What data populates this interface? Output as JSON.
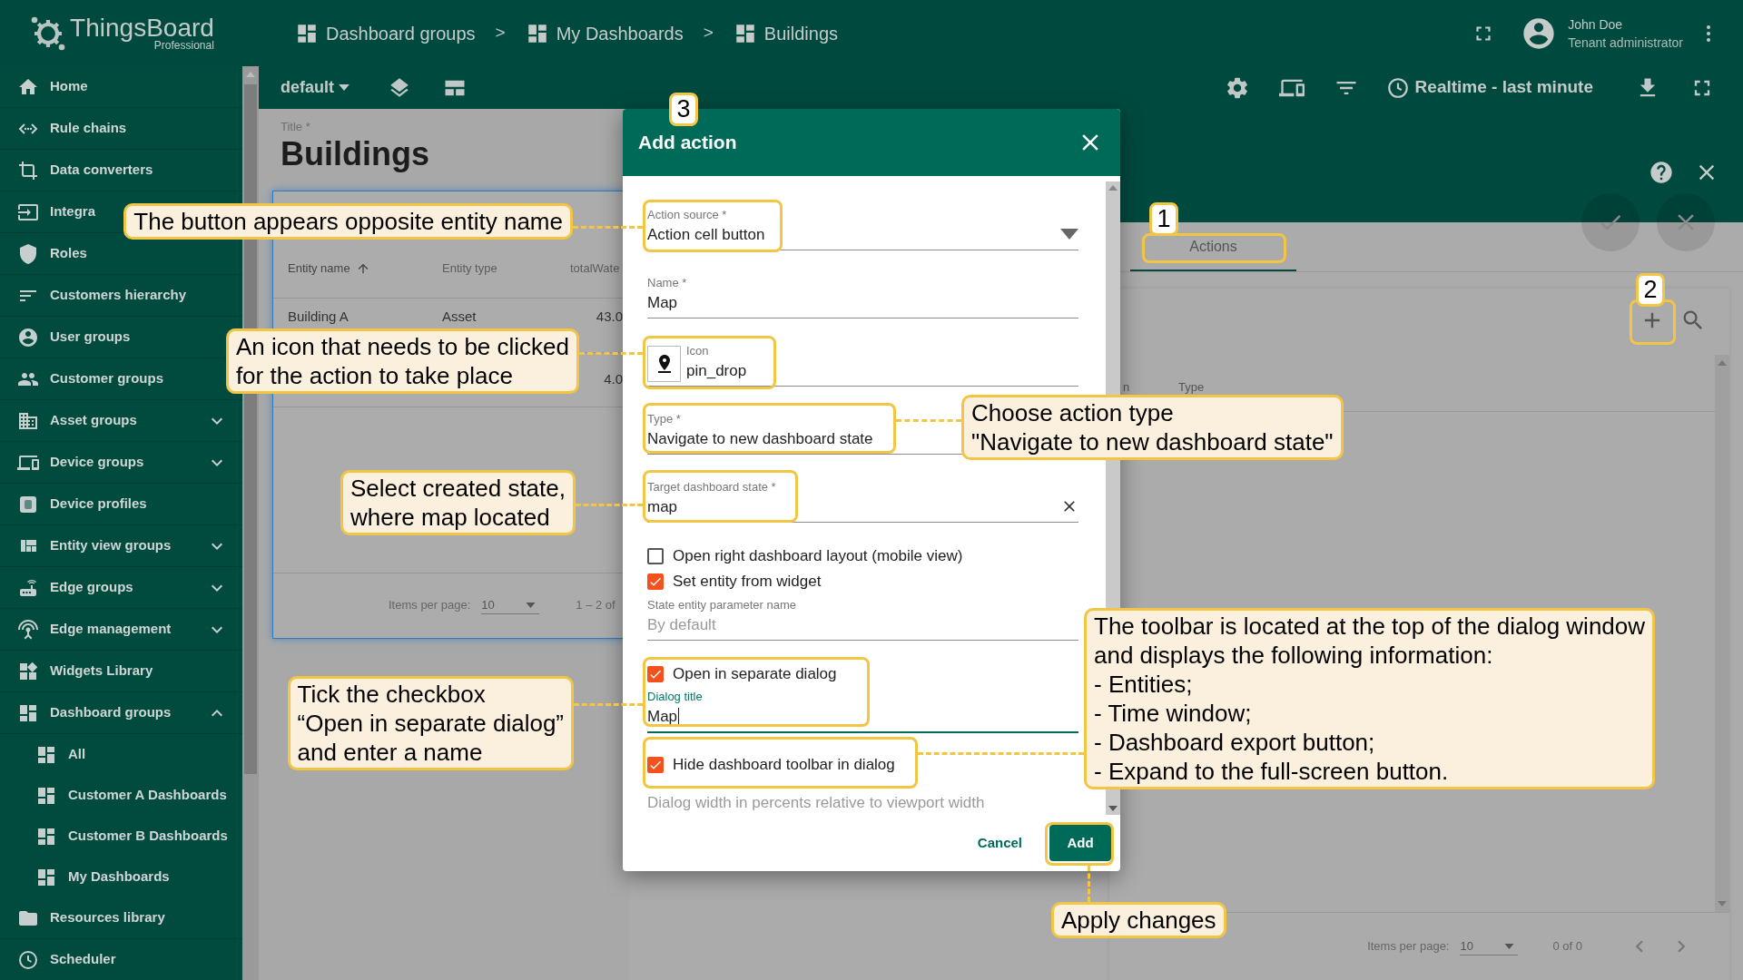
{
  "brand": {
    "name": "ThingsBoard",
    "edition": "Professional"
  },
  "breadcrumbs": [
    {
      "label": "Dashboard groups",
      "separator": ">"
    },
    {
      "label": "My Dashboards",
      "separator": ">"
    },
    {
      "label": "Buildings"
    }
  ],
  "user": {
    "name": "John Doe",
    "role": "Tenant administrator"
  },
  "sidebar": {
    "items": [
      {
        "label": "Home"
      },
      {
        "label": "Rule chains"
      },
      {
        "label": "Data converters"
      },
      {
        "label": "Integra"
      },
      {
        "label": "Roles"
      },
      {
        "label": "Customers hierarchy"
      },
      {
        "label": "User groups"
      },
      {
        "label": "Customer groups"
      },
      {
        "label": "Asset groups",
        "expanded": false
      },
      {
        "label": "Device groups",
        "expanded": false
      },
      {
        "label": "Device profiles"
      },
      {
        "label": "Entity view groups",
        "expanded": false
      },
      {
        "label": "Edge groups",
        "expanded": false
      },
      {
        "label": "Edge management",
        "expanded": false
      },
      {
        "label": "Widgets Library"
      },
      {
        "label": "Dashboard groups",
        "expanded": true,
        "children": [
          {
            "label": "All"
          },
          {
            "label": "Customer A Dashboards"
          },
          {
            "label": "Customer B Dashboards"
          },
          {
            "label": "My Dashboards"
          }
        ]
      },
      {
        "label": "Resources library"
      },
      {
        "label": "Scheduler"
      }
    ]
  },
  "dashboard_toolbar": {
    "state": "default",
    "timewindow": "Realtime - last minute"
  },
  "dashboard": {
    "title_label": "Title *",
    "title": "Buildings",
    "widget": {
      "columns": [
        {
          "label": "Entity name",
          "sorted": true
        },
        {
          "label": "Entity type",
          "sorted": false
        },
        {
          "label": "totalWate",
          "sorted": false
        }
      ],
      "rows": [
        [
          "Building A",
          "Asset",
          "43.0"
        ],
        [
          null,
          null,
          "4.0"
        ]
      ],
      "footer": {
        "items_per_page_label": "Items per page:",
        "items_per_page": "10",
        "range": "1 – 2 of"
      }
    }
  },
  "widget_editor": {
    "tabs": [
      {
        "label": "Actions",
        "selected": true
      }
    ],
    "columns": [
      "n",
      "Type"
    ],
    "footer": {
      "items_per_page_label": "Items per page:",
      "items_per_page": "10",
      "range": "0 of 0"
    }
  },
  "dialog": {
    "title": "Add action",
    "fields": [
      {
        "kind": "select",
        "label": "Action source *",
        "value": "Action cell button",
        "focused": false
      },
      {
        "kind": "text",
        "label": "Name *",
        "value": "Map",
        "focused": false
      },
      {
        "kind": "icon",
        "label": "Icon",
        "value": "pin_drop",
        "focused": false
      },
      {
        "kind": "text",
        "label": "Type *",
        "value": "Navigate to new dashboard state",
        "focused": false
      },
      {
        "kind": "clearable",
        "label": "Target dashboard state *",
        "value": "map",
        "focused": false
      },
      {
        "kind": "checkbox",
        "label": "Open right dashboard layout (mobile view)",
        "checked": false
      },
      {
        "kind": "checkbox",
        "label": "Set entity from widget",
        "checked": true
      },
      {
        "kind": "text",
        "label": "State entity parameter name",
        "placeholder": "By default",
        "focused": false
      },
      {
        "kind": "checkbox",
        "label": "Open in separate dialog",
        "checked": true
      },
      {
        "kind": "text",
        "label": "Dialog title",
        "value": "Map",
        "focused": true
      },
      {
        "kind": "checkbox",
        "label": "Hide dashboard toolbar in dialog",
        "checked": true
      },
      {
        "kind": "text",
        "placeholder": "Dialog width in percents relative to viewport width",
        "focused": false
      }
    ],
    "buttons": [
      {
        "kind": "text",
        "label": "Cancel"
      },
      {
        "kind": "primary",
        "label": "Add"
      }
    ]
  },
  "step_badges": [
    "3",
    "1",
    "2"
  ],
  "callouts": [
    {
      "text": "The button appears opposite entity name"
    },
    {
      "text": "An icon that needs to be clicked\nfor the action to take place"
    },
    {
      "text": "Select created state,\nwhere map located"
    },
    {
      "text": "Tick the checkbox\n“Open in separate dialog”\nand enter a name"
    },
    {
      "text": "Choose action type\n\"Navigate to new dashboard state\""
    },
    {
      "text": "The toolbar is located at the top of the dialog window\nand displays the following information:\n- Entities;\n- Time window;\n- Dashboard export button;\n- Expand to the full-screen button."
    },
    {
      "text": "Apply changes"
    }
  ]
}
